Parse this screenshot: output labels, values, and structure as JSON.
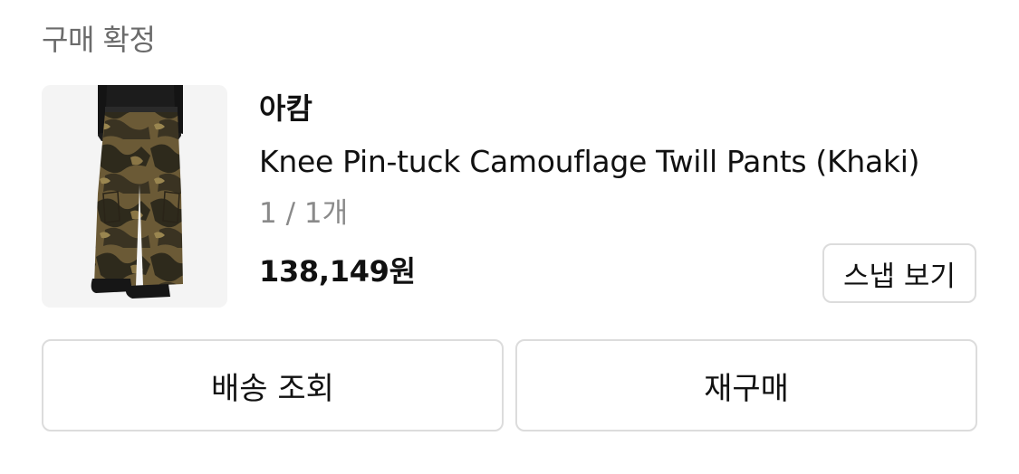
{
  "order": {
    "status_label": "구매 확정",
    "product": {
      "brand": "아캄",
      "name": "Knee Pin-tuck Camouflage Twill Pants (Khaki)",
      "quantity": "1 / 1개",
      "price": "138,149원",
      "image_icon": "product-photo-camouflage-pants"
    },
    "snap_button_label": "스냅 보기",
    "actions": {
      "track_delivery_label": "배송 조회",
      "rebuy_label": "재구매"
    }
  },
  "colors": {
    "status_text": "#6b6b6b",
    "quantity_text": "#8a8a8a",
    "border": "#dcdcdc",
    "thumb_bg": "#f4f4f4"
  }
}
